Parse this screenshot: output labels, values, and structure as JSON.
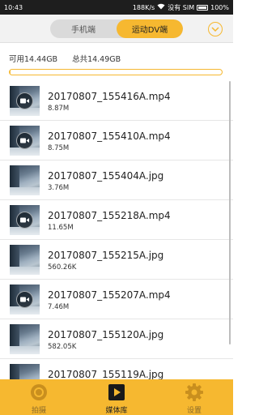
{
  "status_bar": {
    "time": "10:43",
    "speed": "188K/s",
    "no_sim": "没有 SIM",
    "battery": "100%"
  },
  "header": {
    "tabs": [
      {
        "label": "手机端",
        "active": false
      },
      {
        "label": "运动DV端",
        "active": true
      }
    ],
    "menu_icon": "chevron-down-icon"
  },
  "storage": {
    "available": "可用14.44GB",
    "total": "总共14.49GB",
    "used_fraction": 0.003
  },
  "files": [
    {
      "name": "20170807_155416A.mp4",
      "size": "8.87M",
      "video": true
    },
    {
      "name": "20170807_155410A.mp4",
      "size": "8.75M",
      "video": true
    },
    {
      "name": "20170807_155404A.jpg",
      "size": "3.76M",
      "video": false
    },
    {
      "name": "20170807_155218A.mp4",
      "size": "11.65M",
      "video": true
    },
    {
      "name": "20170807_155215A.jpg",
      "size": "560.26K",
      "video": false
    },
    {
      "name": "20170807_155207A.mp4",
      "size": "7.46M",
      "video": true
    },
    {
      "name": "20170807_155120A.jpg",
      "size": "582.05K",
      "video": false
    },
    {
      "name": "20170807_155119A.jpg",
      "size": "",
      "video": false
    }
  ],
  "bottom_nav": [
    {
      "label": "拍摄",
      "icon": "camera-icon",
      "active": false
    },
    {
      "label": "媒体库",
      "icon": "media-library-icon",
      "active": true
    },
    {
      "label": "设置",
      "icon": "gear-icon",
      "active": false
    }
  ],
  "colors": {
    "accent": "#f6b830",
    "status_bar": "#1e1e1e"
  }
}
